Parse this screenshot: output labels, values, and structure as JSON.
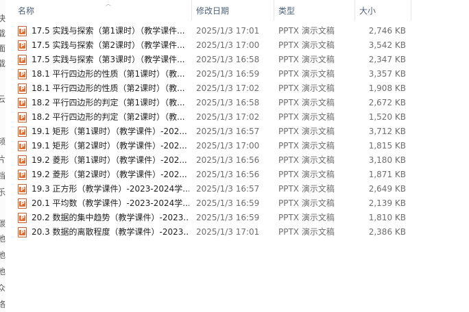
{
  "left_strip_chars": [
    "快",
    "载",
    "面",
    "载",
    "云",
    "频",
    "片",
    "档",
    "乐",
    "碳",
    "地",
    "地",
    "地",
    "众",
    "络"
  ],
  "columns": {
    "name": "名称",
    "date": "修改日期",
    "type": "类型",
    "size": "大小"
  },
  "file_icon": "pptx-file-icon",
  "files": [
    {
      "name": "17.5 实践与探索（第1课时）（教学课件...",
      "date": "2025/1/3 17:01",
      "type": "PPTX 演示文稿",
      "size": "2,746 KB"
    },
    {
      "name": "17.5 实践与探索（第2课时）（教学课件...",
      "date": "2025/1/3 17:00",
      "type": "PPTX 演示文稿",
      "size": "3,542 KB"
    },
    {
      "name": "17.5 实践与探索（第3课时）（教学课件...",
      "date": "2025/1/3 16:58",
      "type": "PPTX 演示文稿",
      "size": "2,347 KB"
    },
    {
      "name": "18.1 平行四边形的性质（第1课时）（教...",
      "date": "2025/1/3 16:59",
      "type": "PPTX 演示文稿",
      "size": "3,357 KB"
    },
    {
      "name": "18.1 平行四边形的性质（第2课时）（教...",
      "date": "2025/1/3 17:02",
      "type": "PPTX 演示文稿",
      "size": "1,908 KB"
    },
    {
      "name": "18.2 平行四边形的判定（第1课时）（教...",
      "date": "2025/1/3 16:58",
      "type": "PPTX 演示文稿",
      "size": "2,672 KB"
    },
    {
      "name": "18.2 平行四边形的判定（第2课时）（教...",
      "date": "2025/1/3 17:02",
      "type": "PPTX 演示文稿",
      "size": "1,520 KB"
    },
    {
      "name": "19.1 矩形（第1课时）（教学课件）-202...",
      "date": "2025/1/3 16:57",
      "type": "PPTX 演示文稿",
      "size": "3,712 KB"
    },
    {
      "name": "19.1 矩形（第2课时）（教学课件）-202...",
      "date": "2025/1/3 17:00",
      "type": "PPTX 演示文稿",
      "size": "1,815 KB"
    },
    {
      "name": "19.2 菱形（第1课时）（教学课件）-202...",
      "date": "2025/1/3 16:56",
      "type": "PPTX 演示文稿",
      "size": "3,180 KB"
    },
    {
      "name": "19.2 菱形（第2课时）（教学课件）-202...",
      "date": "2025/1/3 16:56",
      "type": "PPTX 演示文稿",
      "size": "1,871 KB"
    },
    {
      "name": "19.3 正方形（教学课件）-2023-2024学...",
      "date": "2025/1/3 16:57",
      "type": "PPTX 演示文稿",
      "size": "2,649 KB"
    },
    {
      "name": "20.1 平均数（教学课件）-2023-2024学...",
      "date": "2025/1/3 16:59",
      "type": "PPTX 演示文稿",
      "size": "2,139 KB"
    },
    {
      "name": "20.2 数据的集中趋势（教学课件）-2023...",
      "date": "2025/1/3 16:59",
      "type": "PPTX 演示文稿",
      "size": "1,810 KB"
    },
    {
      "name": "20.3 数据的离散程度（教学课件）-2023...",
      "date": "2025/1/3 17:01",
      "type": "PPTX 演示文稿",
      "size": "2,386 KB"
    }
  ]
}
